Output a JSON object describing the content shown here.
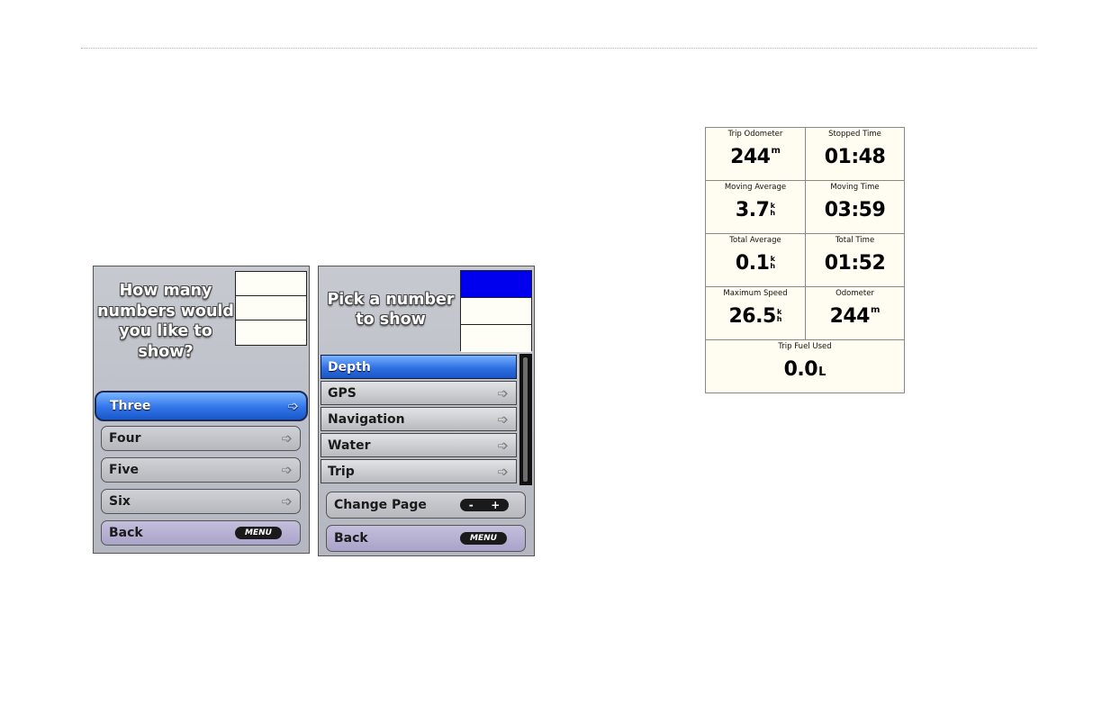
{
  "panel1": {
    "question": "How many numbers would you like to show?",
    "slot_count": 3,
    "options": [
      {
        "label": "Three",
        "selected": true
      },
      {
        "label": "Four",
        "selected": false
      },
      {
        "label": "Five",
        "selected": false
      },
      {
        "label": "Six",
        "selected": false
      }
    ],
    "back": {
      "label": "Back",
      "key": "MENU"
    }
  },
  "panel2": {
    "question": "Pick a number to show",
    "slot_count": 3,
    "active_slot": 1,
    "items": [
      {
        "label": "Depth",
        "selected": true
      },
      {
        "label": "GPS",
        "selected": false
      },
      {
        "label": "Navigation",
        "selected": false
      },
      {
        "label": "Water",
        "selected": false
      },
      {
        "label": "Trip",
        "selected": false
      }
    ],
    "change_page": {
      "label": "Change Page",
      "minus": "-",
      "plus": "+"
    },
    "back": {
      "label": "Back",
      "key": "MENU"
    }
  },
  "trip": {
    "cells": [
      {
        "label": "Trip Odometer",
        "value": "244",
        "unit": "m"
      },
      {
        "label": "Stopped Time",
        "value": "01:48",
        "unit": ""
      },
      {
        "label": "Moving Average",
        "value": "3.7",
        "unit_top": "k",
        "unit_bottom": "h"
      },
      {
        "label": "Moving Time",
        "value": "03:59",
        "unit": ""
      },
      {
        "label": "Total Average",
        "value": "0.1",
        "unit_top": "k",
        "unit_bottom": "h"
      },
      {
        "label": "Total Time",
        "value": "01:52",
        "unit": ""
      },
      {
        "label": "Maximum Speed",
        "value": "26.5",
        "unit_top": "k",
        "unit_bottom": "h"
      },
      {
        "label": "Odometer",
        "value": "244",
        "unit": "m"
      }
    ],
    "fuel": {
      "label": "Trip Fuel Used",
      "value": "0.0",
      "unit": "L"
    }
  },
  "colors": {
    "selected_blue": "#2f70e4",
    "active_slot": "#0000ee",
    "back_lavender": "#b8b3d6"
  }
}
